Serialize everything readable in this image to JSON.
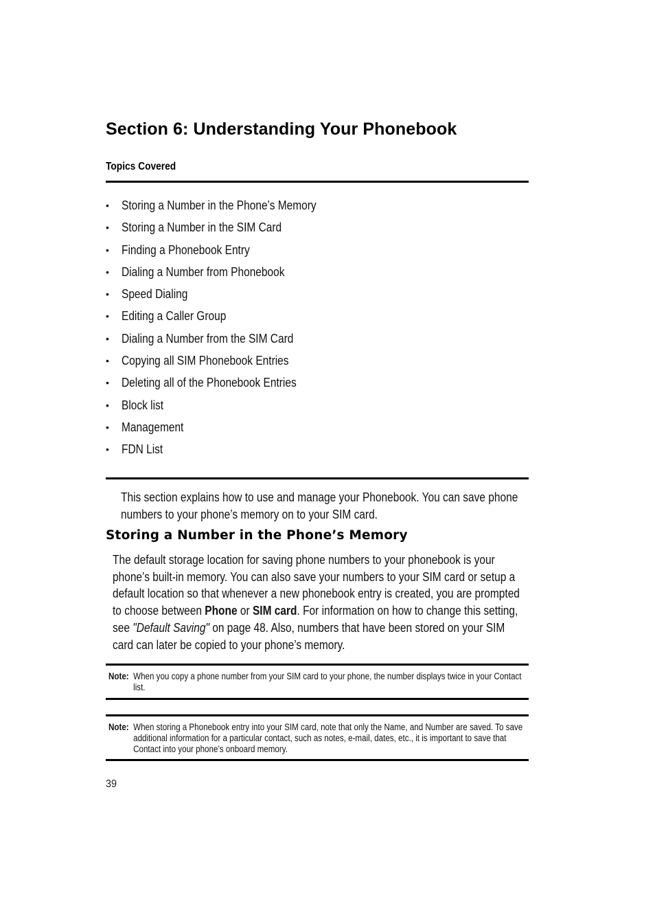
{
  "section_title": "Section 6: Understanding Your Phonebook",
  "topics_heading": "Topics Covered",
  "topics": [
    "Storing a Number in the Phone’s Memory",
    "Storing a Number in the SIM Card",
    "Finding a Phonebook Entry",
    "Dialing a Number from Phonebook",
    "Speed Dialing",
    "Editing a Caller Group",
    "Dialing a Number from the SIM Card",
    "Copying all SIM Phonebook Entries",
    "Deleting all of the Phonebook Entries",
    "Block list",
    "Management",
    "FDN List"
  ],
  "bullet_glyph": "•",
  "intro": "This section explains how to use and manage your Phonebook. You can save phone numbers to your phone’s memory on to your SIM card.",
  "subheading": "Storing a Number in the Phone’s Memory",
  "body": {
    "part1": "The default storage location for saving phone numbers to your phonebook is your phone’s built-in memory. You can also save your numbers to your SIM card or setup a default location so that whenever a new phonebook entry is created, you are prompted to choose between ",
    "bold1": "Phone",
    "part2": " or ",
    "bold2": "SIM card",
    "part3": ". For information on how to change this setting, see ",
    "link": "\"Default Saving\"",
    "part4": "  on page 48. Also, numbers that have been stored on your SIM card can later be copied to your phone’s memory."
  },
  "notes": [
    {
      "label": "Note:",
      "text": "When you copy a phone number from your SIM card to your phone, the number displays twice in your Contact list."
    },
    {
      "label": "Note:",
      "text": "When storing a Phonebook entry into your SIM card, note that only the Name, and Number are saved. To save additional information for a particular contact, such as notes, e-mail, dates, etc., it is important to save that Contact into your phone’s onboard memory."
    }
  ],
  "page_number": "39"
}
